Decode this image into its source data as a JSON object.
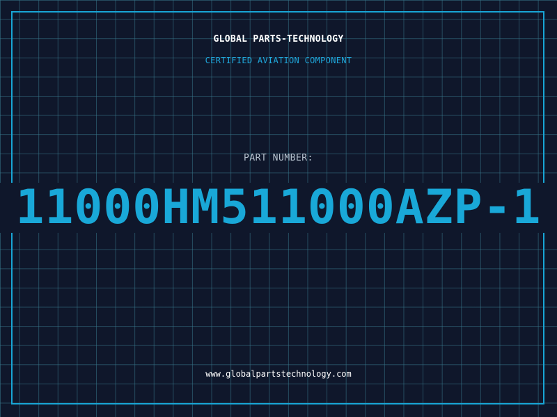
{
  "header": {
    "company": "GLOBAL PARTS-TECHNOLOGY",
    "subtitle": "CERTIFIED AVIATION COMPONENT"
  },
  "part": {
    "label": "PART NUMBER:",
    "number": "11000HM511000AZP-1"
  },
  "footer": {
    "website": "www.globalpartstechnology.com"
  },
  "colors": {
    "background": "#0f172b",
    "accent": "#19a8d8",
    "grid": "#2f6c80",
    "text": "#ffffff"
  }
}
